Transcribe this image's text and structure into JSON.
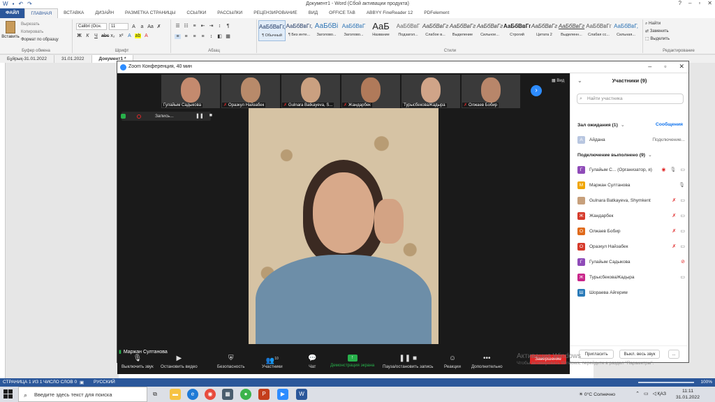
{
  "word": {
    "title": "Документ1 - Word (Сбой активации продукта)",
    "tabs": [
      "ФАЙЛ",
      "ГЛАВНАЯ",
      "ВСТАВКА",
      "ДИЗАЙН",
      "РАЗМЕТКА СТРАНИЦЫ",
      "ССЫЛКИ",
      "РАССЫЛКИ",
      "РЕЦЕНЗИРОВАНИЕ",
      "ВИД",
      "OFFICE TAB",
      "ABBYY FineReader 12",
      "PDFelement"
    ],
    "clipboard": {
      "paste": "Вставить",
      "cut": "Вырезать",
      "copy": "Копировать",
      "format_painter": "Формат по образцу",
      "group": "Буфер обмена"
    },
    "font": {
      "name": "Calibri (Осн.",
      "size": "11",
      "group": "Шрифт"
    },
    "paragraph_group": "Абзац",
    "styles_group": "Стили",
    "styles": [
      {
        "sample": "АаБбВвГг,",
        "label": "¶ Обычный"
      },
      {
        "sample": "АаБбВвГг,",
        "label": "¶ Без инте..."
      },
      {
        "sample": "АаБбВі",
        "label": "Заголово..."
      },
      {
        "sample": "АаБбВвГ",
        "label": "Заголово..."
      },
      {
        "sample": "АаБ",
        "label": "Название"
      },
      {
        "sample": "АаБбВвГ",
        "label": "Подзагол..."
      },
      {
        "sample": "АаБбВвГг",
        "label": "Слабое в..."
      },
      {
        "sample": "АаБбВвГг",
        "label": "Выделение"
      },
      {
        "sample": "АаБбВвГг",
        "label": "Сильное..."
      },
      {
        "sample": "АаБбВвГг",
        "label": "Строгий"
      },
      {
        "sample": "АаБбВвГг",
        "label": "Цитата 2"
      },
      {
        "sample": "АаБбВвГг",
        "label": "Выделенн..."
      },
      {
        "sample": "АаБбВвГг",
        "label": "Слабая сс..."
      },
      {
        "sample": "АаБбВвГ,",
        "label": "Сильная..."
      }
    ],
    "editing": {
      "find": "Найти",
      "replace": "Заменить",
      "select": "Выделить",
      "group": "Редактирование"
    },
    "doc_tabs": [
      "Бұйрық-31.01.2022",
      "31.01.2022",
      "Документ1 *"
    ],
    "status": {
      "page": "СТРАНИЦА 1 ИЗ 1",
      "words": "ЧИСЛО СЛОВ 0",
      "lang": "РУССКИЙ",
      "zoom": "100%"
    }
  },
  "zoom": {
    "window_title": "Zoom Конференция, 40 мин",
    "thumbnails": [
      {
        "name": "Гулайым Садыкова",
        "muted": false,
        "face": "#c48a6e"
      },
      {
        "name": "Оразкул Найзабек",
        "muted": true,
        "face": "#b88a6a"
      },
      {
        "name": "Gulnara Batkayeva, S...",
        "muted": true,
        "face": "#caa080"
      },
      {
        "name": "Жандарбек",
        "muted": true,
        "face": "#b07a5a"
      },
      {
        "name": "ТурысбековаЖадыра",
        "muted": false,
        "face": "#d0a488"
      },
      {
        "name": "Олжаев Бобир",
        "muted": true,
        "face": "#b8866a"
      }
    ],
    "view_label": "Вид",
    "recording_label": "Запись...",
    "active_speaker": "Маржан Султанова",
    "toolbar": {
      "mute": "Выключить звук",
      "stop_video": "Остановить видео",
      "security": "Безопасность",
      "participants": "Участники",
      "participants_count": "10",
      "chat": "Чат",
      "share": "Демонстрация экрана",
      "pause_record": "Пауза/остановить запись",
      "reactions": "Реакции",
      "more": "Дополнительно",
      "end": "Завершение"
    },
    "panel": {
      "title": "Участники (9)",
      "search_placeholder": "Найти участника",
      "waiting_header": "Зал ожидания (1)",
      "messages": "Сообщения",
      "waiting": [
        {
          "initial": "А",
          "name": "Айдана",
          "status": "Подключение...",
          "color": "#b8c6e0"
        }
      ],
      "connected_header": "Подключение выполнено (9)",
      "participants": [
        {
          "initial": "Г",
          "name": "Гулайым С... (Организатор, я)",
          "color": "#8f4bb8",
          "mic": "on",
          "cam": "on"
        },
        {
          "initial": "М",
          "name": "Маржан Султанова",
          "color": "#f0a500",
          "mic": "on",
          "cam": "none"
        },
        {
          "initial": "",
          "name": "Gulnara Batkayeva, Shymkent",
          "color": "#c7a07c",
          "mic": "off",
          "cam": "on"
        },
        {
          "initial": "Ж",
          "name": "Жандарбек",
          "color": "#d63a2b",
          "mic": "off",
          "cam": "on"
        },
        {
          "initial": "О",
          "name": "Олжаев Бобир",
          "color": "#e06a1b",
          "mic": "off",
          "cam": "on"
        },
        {
          "initial": "О",
          "name": "Оразкул Найзабек",
          "color": "#d63a2b",
          "mic": "off",
          "cam": "on"
        },
        {
          "initial": "Г",
          "name": "Гулайым Садыкова",
          "color": "#8f4bb8",
          "mic": "none",
          "cam": "off"
        },
        {
          "initial": "Ж",
          "name": "ТурысбековаЖадыра",
          "color": "#c9258a",
          "mic": "none",
          "cam": "on"
        },
        {
          "initial": "Ш",
          "name": "Шораева Айгерим",
          "color": "#2a7ab8",
          "mic": "none",
          "cam": "none"
        }
      ],
      "invite": "Пригласить",
      "mute_all": "Выкл. весь звук",
      "more": "..."
    }
  },
  "activation": {
    "line1": "Активация Windows",
    "line2": "Чтобы активировать Windows, перейдите в раздел \"Параметры\"."
  },
  "taskbar": {
    "search_placeholder": "Введите здесь текст для поиска",
    "weather": "0°C Солнечно",
    "lang": "ҚАЗ",
    "time": "11:11",
    "date": "31.01.2022"
  }
}
